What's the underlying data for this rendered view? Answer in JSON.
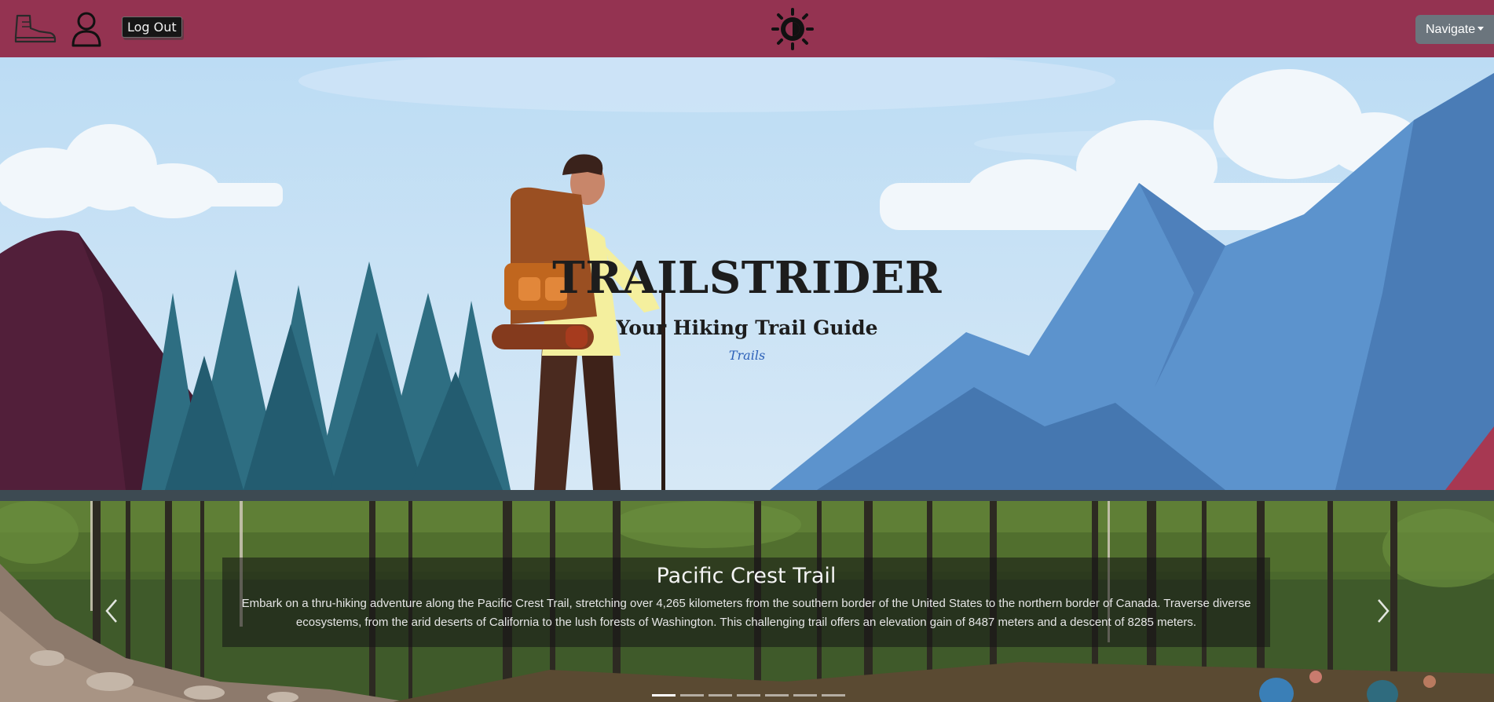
{
  "navbar": {
    "logout_label": "Log Out",
    "navigate_label": "Navigate",
    "background": "#943351",
    "icons": [
      "hiking-boot-icon",
      "user-icon",
      "theme-toggle-icon"
    ]
  },
  "hero": {
    "title": "TRAILSTRIDER",
    "subtitle": "Your Hiking Trail Guide",
    "link_label": "Trails"
  },
  "carousel": {
    "slide_title": "Pacific Crest Trail",
    "slide_description": "Embark on a thru-hiking adventure along the Pacific Crest Trail, stretching over 4,265 kilometers from the southern border of the United States to the northern border of Canada. Traverse diverse ecosystems, from the arid deserts of California to the lush forests of Washington. This challenging trail offers an elevation gain of 8487 meters and a descent of 8285 meters.",
    "indicator_count": 7,
    "active_indicator": 0
  }
}
